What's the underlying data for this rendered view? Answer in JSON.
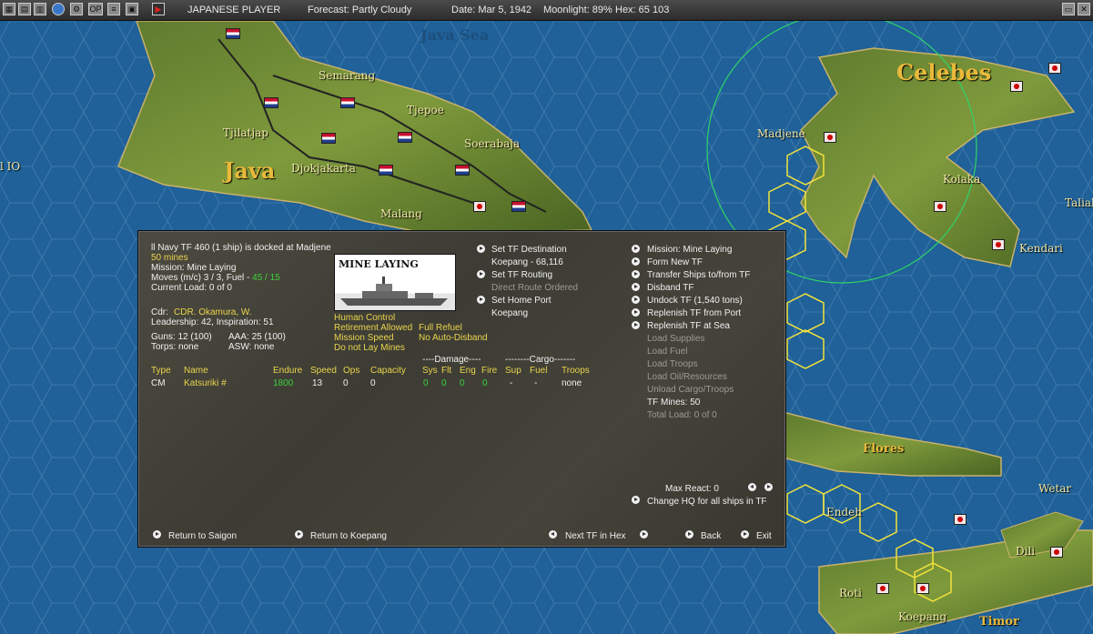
{
  "topbar": {
    "player": "JAPANESE PLAYER",
    "forecast": "Forecast: Partly Cloudy",
    "date": "Date: Mar 5, 1942",
    "moonlight": "Moonlight: 89%",
    "hex": "Hex: 65 103",
    "icons": [
      "map-icon",
      "stack-icon",
      "globe-icon",
      "graph-icon",
      "op-icon",
      "report-icon",
      "window-icon",
      "play-icon"
    ]
  },
  "map": {
    "labels": {
      "java_sea": "Java Sea",
      "celebes": "Celebes",
      "java": "Java",
      "semarang": "Semarang",
      "tjepoe": "Tjepoe",
      "tjilatjap": "Tjilatjap",
      "soerabaja": "Soerabaja",
      "djokjakarta": "Djokjakarta",
      "malang": "Malang",
      "madjene": "Madjene",
      "kolaka": "Kolaka",
      "kendari": "Kendari",
      "taliab": "Taliab",
      "flores": "Flores",
      "wetar": "Wetar",
      "endeh": "Endeh",
      "dili": "Dili",
      "roti": "Roti",
      "koepang": "Koepang",
      "timor": "Timor",
      "io": "l IO"
    }
  },
  "panel": {
    "header": "ll Navy TF 460 (1 ship) is docked at Madjene",
    "mines": "50 mines",
    "mission": "Mission: Mine Laying",
    "moves_prefix": "Moves (m/c) 3 / 3, Fuel - ",
    "fuel": "45 / 15",
    "current_load": "Current Load: 0 of 0",
    "cdr_label": "Cdr:",
    "cdr_name": "CDR. Okamura, W.",
    "leadership": "Leadership: 42, Inspiration: 51",
    "guns": "Guns: 12 (100)",
    "aaa": "AAA: 25 (100)",
    "torps": "Torps: none",
    "asw": "ASW: none",
    "image_caption": "MINE LAYING",
    "human_control": "Human Control",
    "retirement": "Retirement Allowed",
    "full_refuel": "Full Refuel",
    "mission_speed": "Mission Speed",
    "no_auto_disband": "No Auto-Disband",
    "do_not_lay": "Do not Lay Mines",
    "mid": {
      "set_dest": "Set TF Destination",
      "dest_value": "Koepang - 68,116",
      "set_routing": "Set TF Routing",
      "direct_route": "Direct Route Ordered",
      "set_home": "Set Home Port",
      "home_value": "Koepang"
    },
    "right": {
      "mission": "Mission: Mine Laying",
      "form_new": "Form New TF",
      "transfer": "Transfer Ships to/from TF",
      "disband": "Disband TF",
      "undock": "Undock TF (1,540 tons)",
      "replenish_port": "Replenish TF from Port",
      "replenish_sea": "Replenish TF at Sea",
      "load_supplies": "Load Supplies",
      "load_fuel": "Load Fuel",
      "load_troops": "Load Troops",
      "load_oil": "Load Oil/Resources",
      "unload": "Unload Cargo/Troops",
      "tf_mines": "TF Mines: 50",
      "total_load": "Total Load: 0 of 0"
    },
    "table": {
      "damage_header": "----Damage----",
      "cargo_header": "--------Cargo-------",
      "columns": [
        "Type",
        "Name",
        "Endure",
        "Speed",
        "Ops",
        "Capacity",
        "Sys",
        "Flt",
        "Eng",
        "Fire",
        "Sup",
        "Fuel",
        "Troops"
      ],
      "rows": [
        [
          "CM",
          "Katsuriki #",
          "1800",
          "13",
          "0",
          "0",
          "0",
          "0",
          "0",
          "0",
          "-",
          "-",
          "none"
        ]
      ]
    },
    "max_react": "Max React: 0",
    "change_hq": "Change HQ for all ships in TF",
    "bottom": {
      "return_saigon": "Return to Saigon",
      "return_koepang": "Return to Koepang",
      "next_tf": "Next TF in Hex",
      "back": "Back",
      "exit": "Exit"
    }
  }
}
